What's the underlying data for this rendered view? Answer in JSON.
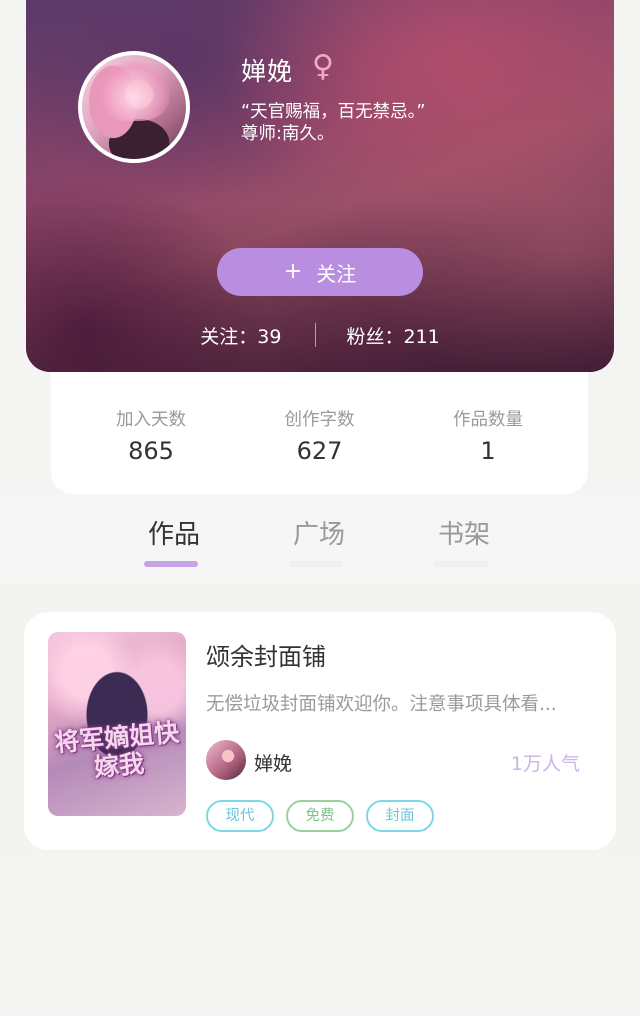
{
  "profile": {
    "name": "婵娩",
    "gender_icon": "♀",
    "bio_line1": "“天官赐福，百无禁忌。”",
    "bio_line2": "尊师:南久。",
    "follow_label": "关注",
    "following_text": "关注：39",
    "followers_text": "粉丝：211"
  },
  "stats": [
    {
      "label": "加入天数",
      "value": "865"
    },
    {
      "label": "创作字数",
      "value": "627"
    },
    {
      "label": "作品数量",
      "value": "1"
    }
  ],
  "tabs": [
    {
      "label": "作品",
      "active": true
    },
    {
      "label": "广场",
      "active": false
    },
    {
      "label": "书架",
      "active": false
    }
  ],
  "works": [
    {
      "cover_title": "将军嫡姐快嫁我",
      "title": "颂余封面铺",
      "description": "无偿垃圾封面铺欢迎你。注意事项具体看...",
      "author": "婵娩",
      "popularity": "1万人气",
      "tags": [
        "现代",
        "免费",
        "封面"
      ]
    }
  ],
  "colors": {
    "accent": "#b98de0",
    "tab_active_underline": "#c4a3e6",
    "popularity": "#cbb2e8",
    "tag_cyan": "#7fd7e5",
    "tag_green": "#9ad1a0"
  },
  "icons": {
    "gender": "female-icon",
    "follow": "plus-icon"
  }
}
